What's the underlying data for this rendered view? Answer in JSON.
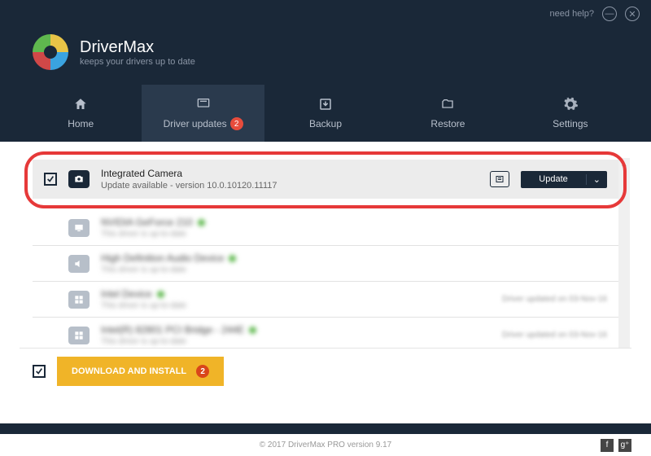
{
  "topbar": {
    "help": "need help?"
  },
  "brand": {
    "title": "DriverMax",
    "subtitle": "keeps your drivers up to date"
  },
  "nav": {
    "home": "Home",
    "updates": "Driver updates",
    "updates_badge": "2",
    "backup": "Backup",
    "restore": "Restore",
    "settings": "Settings"
  },
  "rows": {
    "r0": {
      "title": "Integrated Camera",
      "sub": "Update available - version 10.0.10120.11117",
      "update": "Update"
    },
    "r1": {
      "title": "NVIDIA GeForce 210",
      "sub": "This driver is up-to-date"
    },
    "r2": {
      "title": "High Definition Audio Device",
      "sub": "This driver is up-to-date"
    },
    "r3": {
      "title": "Intel Device",
      "sub": "This driver is up-to-date",
      "note": "Driver updated on 03-Nov-16"
    },
    "r4": {
      "title": "Intel(R) 82801 PCI Bridge - 244E",
      "sub": "This driver is up-to-date",
      "note": "Driver updated on 03-Nov-16"
    }
  },
  "actions": {
    "download": "DOWNLOAD AND INSTALL",
    "download_badge": "2"
  },
  "footer": {
    "copyright": "© 2017 DriverMax PRO version 9.17"
  }
}
